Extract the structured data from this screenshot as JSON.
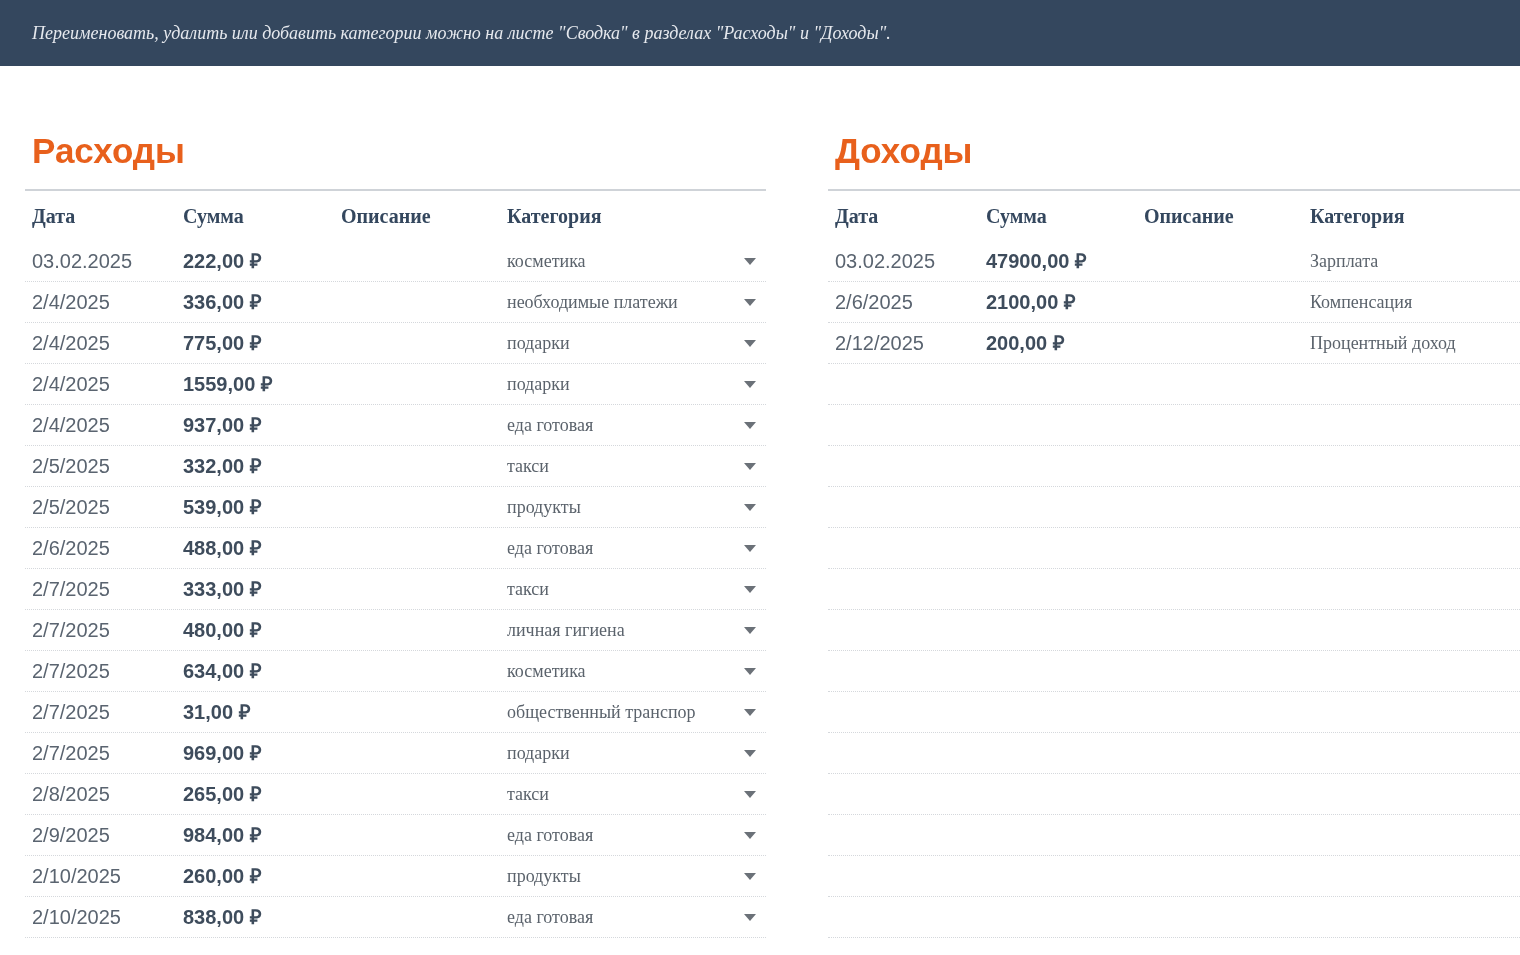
{
  "banner": {
    "text": "Переименовать, удалить или добавить категории можно на листе \"Сводка\" в разделах \"Расходы\" и \"Доходы\"."
  },
  "tables": [
    {
      "title": "Расходы",
      "has_dropdown": true,
      "columns": [
        "Дата",
        "Сумма",
        "Описание",
        "Категория"
      ],
      "rows": [
        {
          "date": "03.02.2025",
          "amount": "222,00 ₽",
          "category": "косметика"
        },
        {
          "date": "2/4/2025",
          "amount": "336,00 ₽",
          "category": "необходимые платежи"
        },
        {
          "date": "2/4/2025",
          "amount": "775,00 ₽",
          "category": "подарки"
        },
        {
          "date": "2/4/2025",
          "amount": "1559,00 ₽",
          "category": "подарки"
        },
        {
          "date": "2/4/2025",
          "amount": "937,00 ₽",
          "category": "еда готовая"
        },
        {
          "date": "2/5/2025",
          "amount": "332,00 ₽",
          "category": "такси"
        },
        {
          "date": "2/5/2025",
          "amount": "539,00 ₽",
          "category": "продукты"
        },
        {
          "date": "2/6/2025",
          "amount": "488,00 ₽",
          "category": "еда готовая"
        },
        {
          "date": "2/7/2025",
          "amount": "333,00 ₽",
          "category": "такси"
        },
        {
          "date": "2/7/2025",
          "amount": "480,00 ₽",
          "category": "личная гигиена"
        },
        {
          "date": "2/7/2025",
          "amount": "634,00 ₽",
          "category": "косметика"
        },
        {
          "date": "2/7/2025",
          "amount": "31,00 ₽",
          "category": "общественный транспор"
        },
        {
          "date": "2/7/2025",
          "amount": "969,00 ₽",
          "category": "подарки"
        },
        {
          "date": "2/8/2025",
          "amount": "265,00 ₽",
          "category": "такси"
        },
        {
          "date": "2/9/2025",
          "amount": "984,00 ₽",
          "category": "еда готовая"
        },
        {
          "date": "2/10/2025",
          "amount": "260,00 ₽",
          "category": "продукты"
        },
        {
          "date": "2/10/2025",
          "amount": "838,00 ₽",
          "category": "еда готовая"
        }
      ]
    },
    {
      "title": "Доходы",
      "has_dropdown": false,
      "columns": [
        "Дата",
        "Сумма",
        "Описание",
        "Категория"
      ],
      "rows": [
        {
          "date": "03.02.2025",
          "amount": "47900,00 ₽",
          "category": "Зарплата"
        },
        {
          "date": "2/6/2025",
          "amount": "2100,00 ₽",
          "category": "Компенсация"
        },
        {
          "date": "2/12/2025",
          "amount": "200,00 ₽",
          "category": "Процентный доход"
        }
      ]
    }
  ]
}
